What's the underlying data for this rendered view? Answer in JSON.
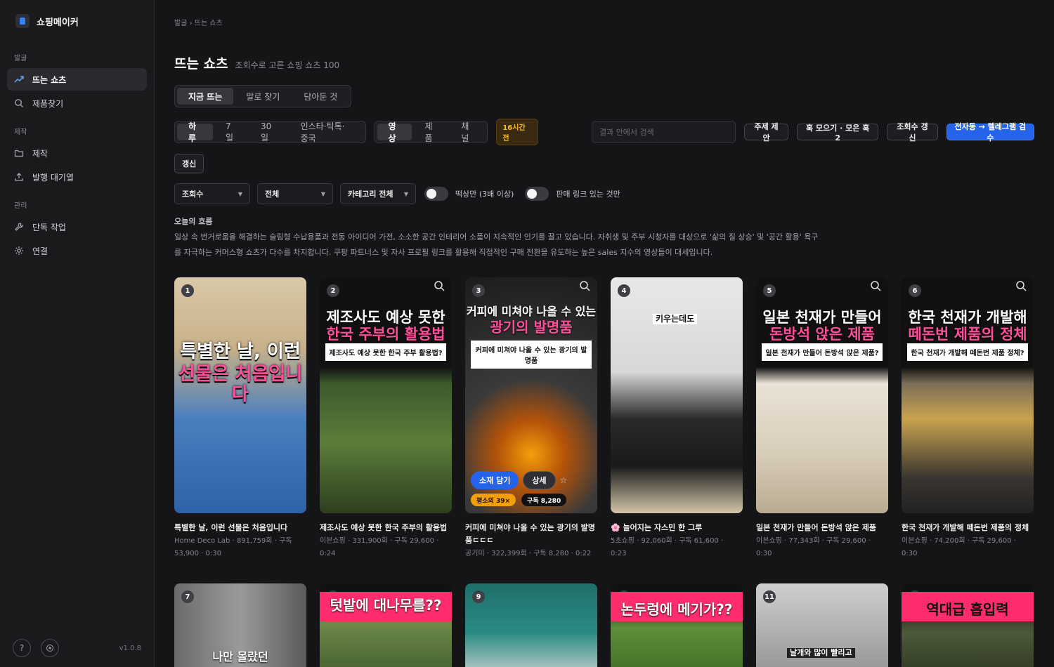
{
  "brand": {
    "name": "쇼핑메이커"
  },
  "sidebar": {
    "sections": [
      {
        "label": "발굴",
        "items": [
          {
            "label": "뜨는 쇼츠",
            "icon": "trending-icon",
            "active": true
          },
          {
            "label": "제품찾기",
            "icon": "search-icon"
          }
        ]
      },
      {
        "label": "제작",
        "items": [
          {
            "label": "제작",
            "icon": "folder-icon"
          },
          {
            "label": "발행 대기열",
            "icon": "upload-icon"
          }
        ]
      },
      {
        "label": "관리",
        "items": [
          {
            "label": "단독 작업",
            "icon": "wrench-icon"
          },
          {
            "label": "연결",
            "icon": "gear-icon"
          }
        ]
      }
    ],
    "footer": {
      "help": "?",
      "version": "v1.0.8"
    }
  },
  "breadcrumb": "발굴 › 뜨는 쇼츠",
  "header": {
    "title": "뜨는 쇼츠",
    "subtitle": "조회수로 고른 쇼핑 쇼츠 100"
  },
  "main_tabs": [
    "지금 뜨는",
    "말로 찾기",
    "담아둔 것"
  ],
  "period_tabs": [
    "하루",
    "7일",
    "30일",
    "인스타·틱톡·중국"
  ],
  "type_tabs": [
    "영상",
    "제품",
    "채널"
  ],
  "freshness_badge": "16시간 전",
  "search": {
    "placeholder": "결과 안에서 검색",
    "value": ""
  },
  "actions": {
    "suggest": "주제 제안",
    "hook": "훅 모으기 · 모은 훅 2",
    "views_refresh": "조회수 갱신",
    "telegram": "전자동 → 텔레그램 검수",
    "refresh": "갱신"
  },
  "filters": {
    "sort": "조회수",
    "scope": "전체",
    "category": "카테고리 전체",
    "toggle1": "떡상만 (3배 이상)",
    "toggle2": "판매 링크 있는 것만"
  },
  "flow": {
    "title": "오늘의 흐름",
    "line1": "일상 속 번거로움을 해결하는 슬림형 수납용품과 전동 아이디어 가전, 소소한 공간 인테리어 소품이 지속적인 인기를 끌고 있습니다. 자취생 및 주부 시청자를 대상으로 '삶의 질 상승' 및 '공간 활용' 욕구",
    "line2": "를 자극하는 커머스형 쇼츠가 다수를 차지합니다. 쿠팡 파트너스 및 자사 프로필 링크를 활용해 직접적인 구매 전환을 유도하는 높은 sales 지수의 영상들이 대세입니다."
  },
  "cards": [
    {
      "rank": "1",
      "cap1": "특별한 날, 이런",
      "cap2": "선물은 처음입니다",
      "title": "특별한 날, 이런 선물은 처음입니다",
      "meta1": "Home Deco Lab · 891,759회 · 구독",
      "meta2": "53,900 · 0:30"
    },
    {
      "rank": "2",
      "cap1": "제조사도 예상 못한",
      "cap2": "한국 주부의 활용법",
      "box": "제조사도 예상 못한 한국 주부 활용법?",
      "title": "제조사도 예상 못한 한국 주부의 활용법",
      "meta1": "이븐쇼핑 · 331,900회 · 구독 29,600 ·",
      "meta2": "0:24"
    },
    {
      "rank": "3",
      "cap1": "커피에 미쳐야 나올 수 있는",
      "cap2": "광기의 발명품",
      "box": "커피에 미쳐야 나올 수 있는 광기의 발명품",
      "title": "커피에 미쳐야 나올 수 있는 광기의 발명품ㄷㄷㄷ",
      "meta1": "공기미 · 322,399회 · 구독 8,280 · 0:22",
      "meta2": "",
      "add": "소재 담기",
      "detail": "상세",
      "ratio": "평소의 39×",
      "subs": "구독 8,280"
    },
    {
      "rank": "4",
      "cap1": "키우는데도",
      "cap2": "",
      "title": "🌸 늘어지는 자스민 한 그루",
      "meta1": "5초쇼핑 · 92,060회 · 구독 61,600 ·",
      "meta2": "0:23"
    },
    {
      "rank": "5",
      "cap1": "일본 천재가 만들어",
      "cap2": "돈방석 앉은 제품",
      "box": "일본 천재가 만들어 돈방석 앉은 제품?",
      "title": "일본 천재가 만들어 돈방석 앉은 제품",
      "meta1": "이븐쇼핑 · 77,343회 · 구독 29,600 ·",
      "meta2": "0:30"
    },
    {
      "rank": "6",
      "cap1": "한국 천재가 개발해",
      "cap2": "떼돈번 제품의 정체",
      "box": "한국 천재가 개발해 떼돈번 제품 정체?",
      "title": "한국 천재가 개발해 떼돈번 제품의 정체",
      "meta1": "이븐쇼핑 · 74,200회 · 구독 29,600 ·",
      "meta2": "0:30"
    }
  ],
  "cards_row2": [
    {
      "rank": "7",
      "cap": "나만 몰랐던"
    },
    {
      "rank": "8",
      "cap": "텃밭에 대나무를??"
    },
    {
      "rank": "9",
      "cap": ""
    },
    {
      "rank": "10",
      "cap": "논두렁에 메기가??"
    },
    {
      "rank": "11",
      "cap": "날개와 많이 빨리고"
    },
    {
      "rank": "12",
      "cap": "역대급 흡입력"
    }
  ],
  "colors": {
    "accent": "#2563eb",
    "pink_caption": "#ff4f9a",
    "badge_orange": "#fbbf24"
  }
}
